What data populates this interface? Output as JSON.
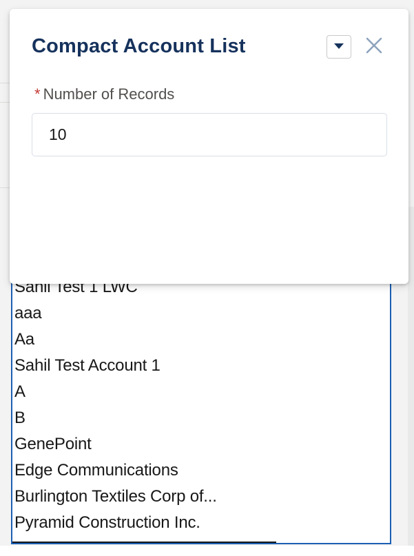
{
  "popover": {
    "title": "Compact Account List",
    "field_label": "Number of Records",
    "required_marker": "*",
    "field_value": "10",
    "dropdown_icon": "chevron-down-icon",
    "close_icon": "close-icon"
  },
  "account_list": {
    "items": [
      "Sahil Test 1 LWC",
      "aaa",
      "Aa",
      "Sahil Test Account 1",
      "A",
      "B",
      "GenePoint",
      "Edge Communications",
      "Burlington Textiles Corp of...",
      "Pyramid Construction Inc."
    ]
  },
  "colors": {
    "title": "#16325c",
    "required": "#c23934",
    "list_border": "#1b5fb3"
  }
}
